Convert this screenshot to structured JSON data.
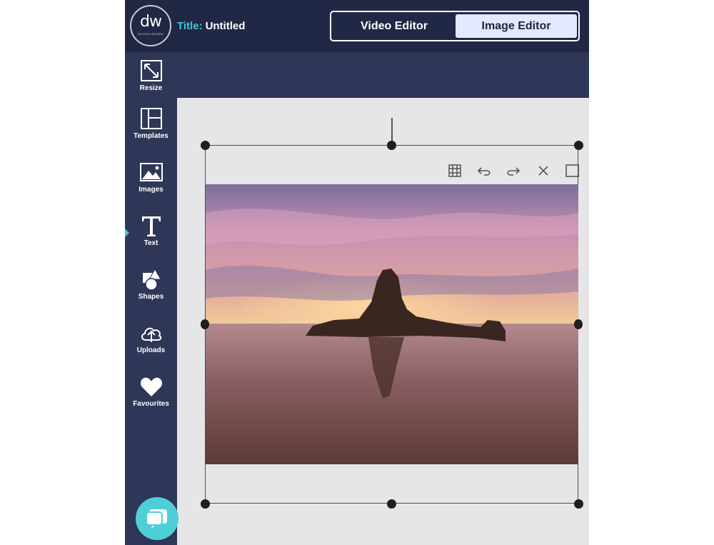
{
  "header": {
    "logo": {
      "mark": "dw",
      "subtitle": "DESIGN WIZARD"
    },
    "title_label": "Title:",
    "title_value": "Untitled",
    "mode_switch": {
      "video_label": "Video Editor",
      "image_label": "Image Editor",
      "active": "Image Editor"
    }
  },
  "sidebar": {
    "items": [
      {
        "label": "Resize",
        "icon": "resize-icon"
      },
      {
        "label": "Templates",
        "icon": "templates-icon"
      },
      {
        "label": "Images",
        "icon": "images-icon"
      },
      {
        "label": "Text",
        "icon": "text-icon"
      },
      {
        "label": "Shapes",
        "icon": "shapes-icon"
      },
      {
        "label": "Uploads",
        "icon": "cloud-upload-icon"
      },
      {
        "label": "Favourites",
        "icon": "heart-icon"
      }
    ],
    "active_item": "Text",
    "expand_icon": "chevron-right-icon",
    "chat_icon": "chat-bubble-icon"
  },
  "canvas": {
    "element_toolbar": [
      "grid-icon",
      "undo-icon",
      "redo-icon",
      "close-icon",
      "square-icon"
    ],
    "image_description_icon": "photo-image"
  },
  "colors": {
    "header_bg": "#212846",
    "sidebar_bg": "#2e3757",
    "accent": "#40c4d5",
    "chat_button": "#4ecfd8",
    "active_segment": "#e4e9ff",
    "canvas_bg": "#e6e6e8"
  }
}
